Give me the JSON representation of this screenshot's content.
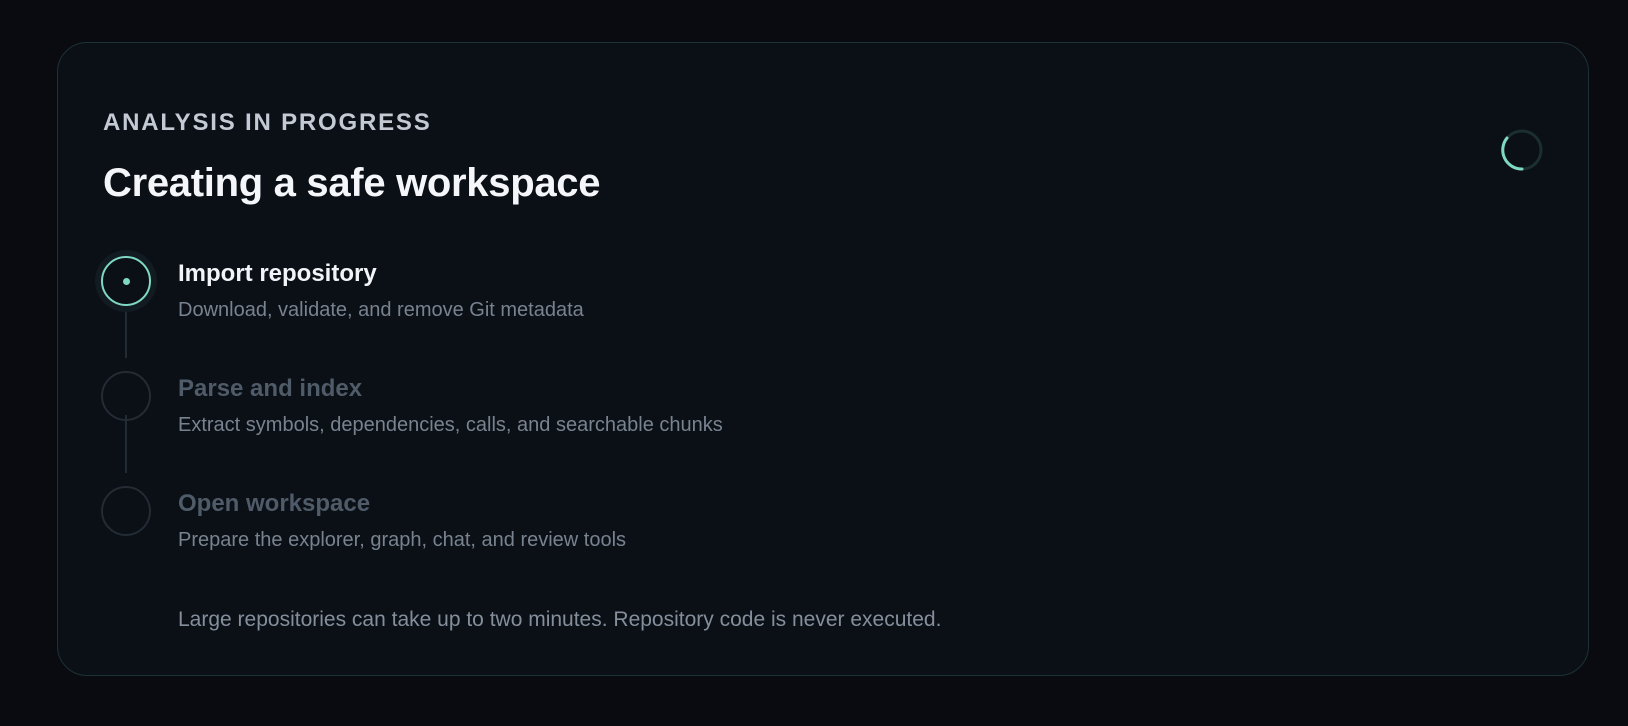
{
  "panel": {
    "eyebrow": "ANALYSIS IN PROGRESS",
    "title": "Creating a safe workspace",
    "accent_color": "#7fd8c4",
    "spinner_icon": "loading-spinner-icon"
  },
  "steps": [
    {
      "title": "Import repository",
      "description": "Download, validate, and remove Git metadata",
      "state": "active"
    },
    {
      "title": "Parse and index",
      "description": "Extract symbols, dependencies, calls, and searchable chunks",
      "state": "pending"
    },
    {
      "title": "Open workspace",
      "description": "Prepare the explorer, graph, chat, and review tools",
      "state": "pending"
    }
  ],
  "footnote": "Large repositories can take up to two minutes. Repository code is never executed."
}
